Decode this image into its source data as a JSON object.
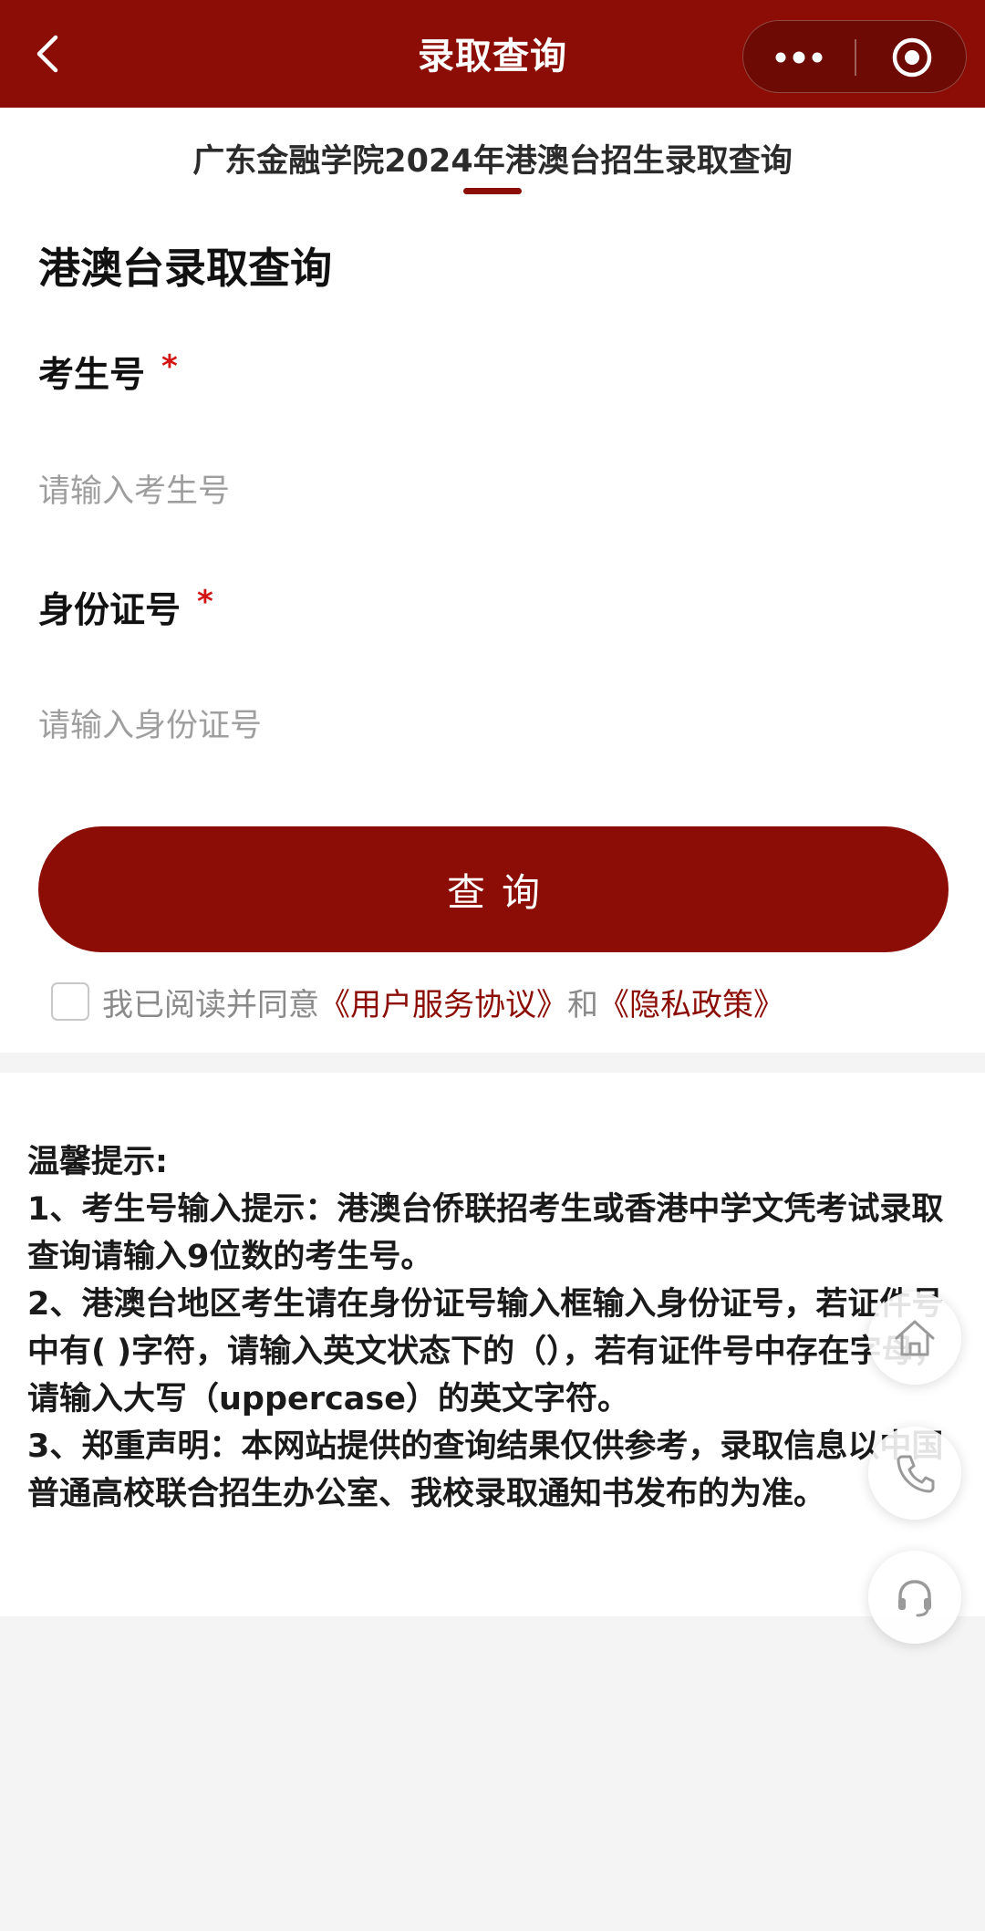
{
  "navbar": {
    "title": "录取查询",
    "back_icon": "chevron-left-icon",
    "more_icon": "more-dots-icon",
    "close_icon": "target-circle-icon"
  },
  "tab": {
    "label": "广东金融学院2024年港澳台招生录取查询"
  },
  "form": {
    "title": "港澳台录取查询",
    "exam_number": {
      "label": "考生号",
      "required_mark": "*",
      "placeholder": "请输入考生号",
      "value": ""
    },
    "id_number": {
      "label": "身份证号",
      "required_mark": "*",
      "placeholder": "请输入身份证号",
      "value": ""
    },
    "submit_label": "查询"
  },
  "agreement": {
    "checked": false,
    "prefix": "我已阅读并同意",
    "terms_link": "《用户服务协议》",
    "conjunction": "和",
    "privacy_link": "《隐私政策》"
  },
  "tips": {
    "heading": "温馨提示:",
    "items": [
      "1、考生号输入提示：港澳台侨联招考生或香港中学文凭考试录取查询请输入9位数的考生号。",
      "2、港澳台地区考生请在身份证号输入框输入身份证号，若证件号中有( )字符，请输入英文状态下的（），若有证件号中存在字母，请输入大写（uppercase）的英文字符。",
      "3、郑重声明：本网站提供的查询结果仅供参考，录取信息以中国普通高校联合招生办公室、我校录取通知书发布的为准。"
    ]
  },
  "floating_buttons": {
    "home_icon": "home-icon",
    "phone_icon": "phone-icon",
    "support_icon": "headset-icon"
  },
  "colors": {
    "brand": "#8b0d05",
    "required": "#d21414",
    "placeholder": "#9e9e9e",
    "background": "#f4f4f4"
  }
}
